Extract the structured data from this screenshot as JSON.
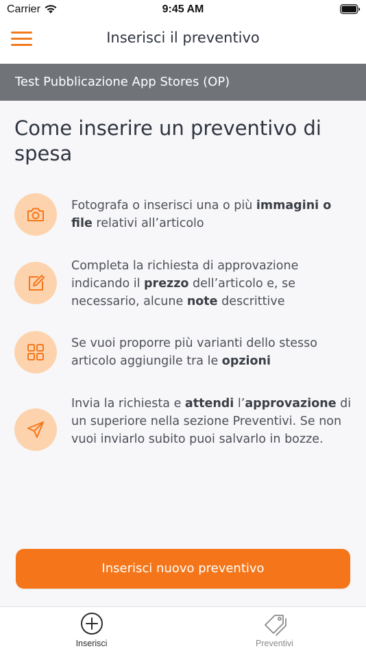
{
  "status_bar": {
    "carrier": "Carrier",
    "time": "9:45 AM"
  },
  "header": {
    "title": "Inserisci il preventivo",
    "menu_icon": "hamburger-menu-icon"
  },
  "org_bar": {
    "name": "Test Pubblicazione App Stores (OP)"
  },
  "main": {
    "title": "Come inserire un preventivo di spesa",
    "steps": [
      {
        "icon": "camera-icon",
        "parts": [
          {
            "text": "Fotografa o inserisci una o più ",
            "bold": false
          },
          {
            "text": "immagini o file",
            "bold": true
          },
          {
            "text": " relativi all’articolo",
            "bold": false
          }
        ]
      },
      {
        "icon": "edit-icon",
        "parts": [
          {
            "text": "Completa la richiesta di approvazione indicando il ",
            "bold": false
          },
          {
            "text": "prezzo",
            "bold": true
          },
          {
            "text": " dell’articolo e, se necessario, alcune ",
            "bold": false
          },
          {
            "text": "note",
            "bold": true
          },
          {
            "text": " descrittive",
            "bold": false
          }
        ]
      },
      {
        "icon": "grid-icon",
        "parts": [
          {
            "text": "Se vuoi proporre più varianti dello stesso articolo aggiungile tra le ",
            "bold": false
          },
          {
            "text": "opzioni",
            "bold": true
          }
        ]
      },
      {
        "icon": "send-icon",
        "parts": [
          {
            "text": "Invia la richiesta e ",
            "bold": false
          },
          {
            "text": "attendi",
            "bold": true
          },
          {
            "text": " l’",
            "bold": false
          },
          {
            "text": "approvazione",
            "bold": true
          },
          {
            "text": " di un superiore nella sezione Preventivi. Se non vuoi inviarlo subito puoi salvarlo in bozze.",
            "bold": false
          }
        ]
      }
    ],
    "primary_button_label": "Inserisci nuovo preventivo"
  },
  "tab_bar": {
    "tabs": [
      {
        "label": "Inserisci",
        "icon": "plus-circle-icon",
        "active": true
      },
      {
        "label": "Preventivi",
        "icon": "tags-icon",
        "active": false
      }
    ]
  },
  "colors": {
    "accent": "#f5761a",
    "icon_bg": "#fdd3ae",
    "org_bar": "#707479",
    "text": "#3a3f47",
    "tab_active": "#2b2b2b",
    "tab_inactive": "#8a8a8a"
  }
}
